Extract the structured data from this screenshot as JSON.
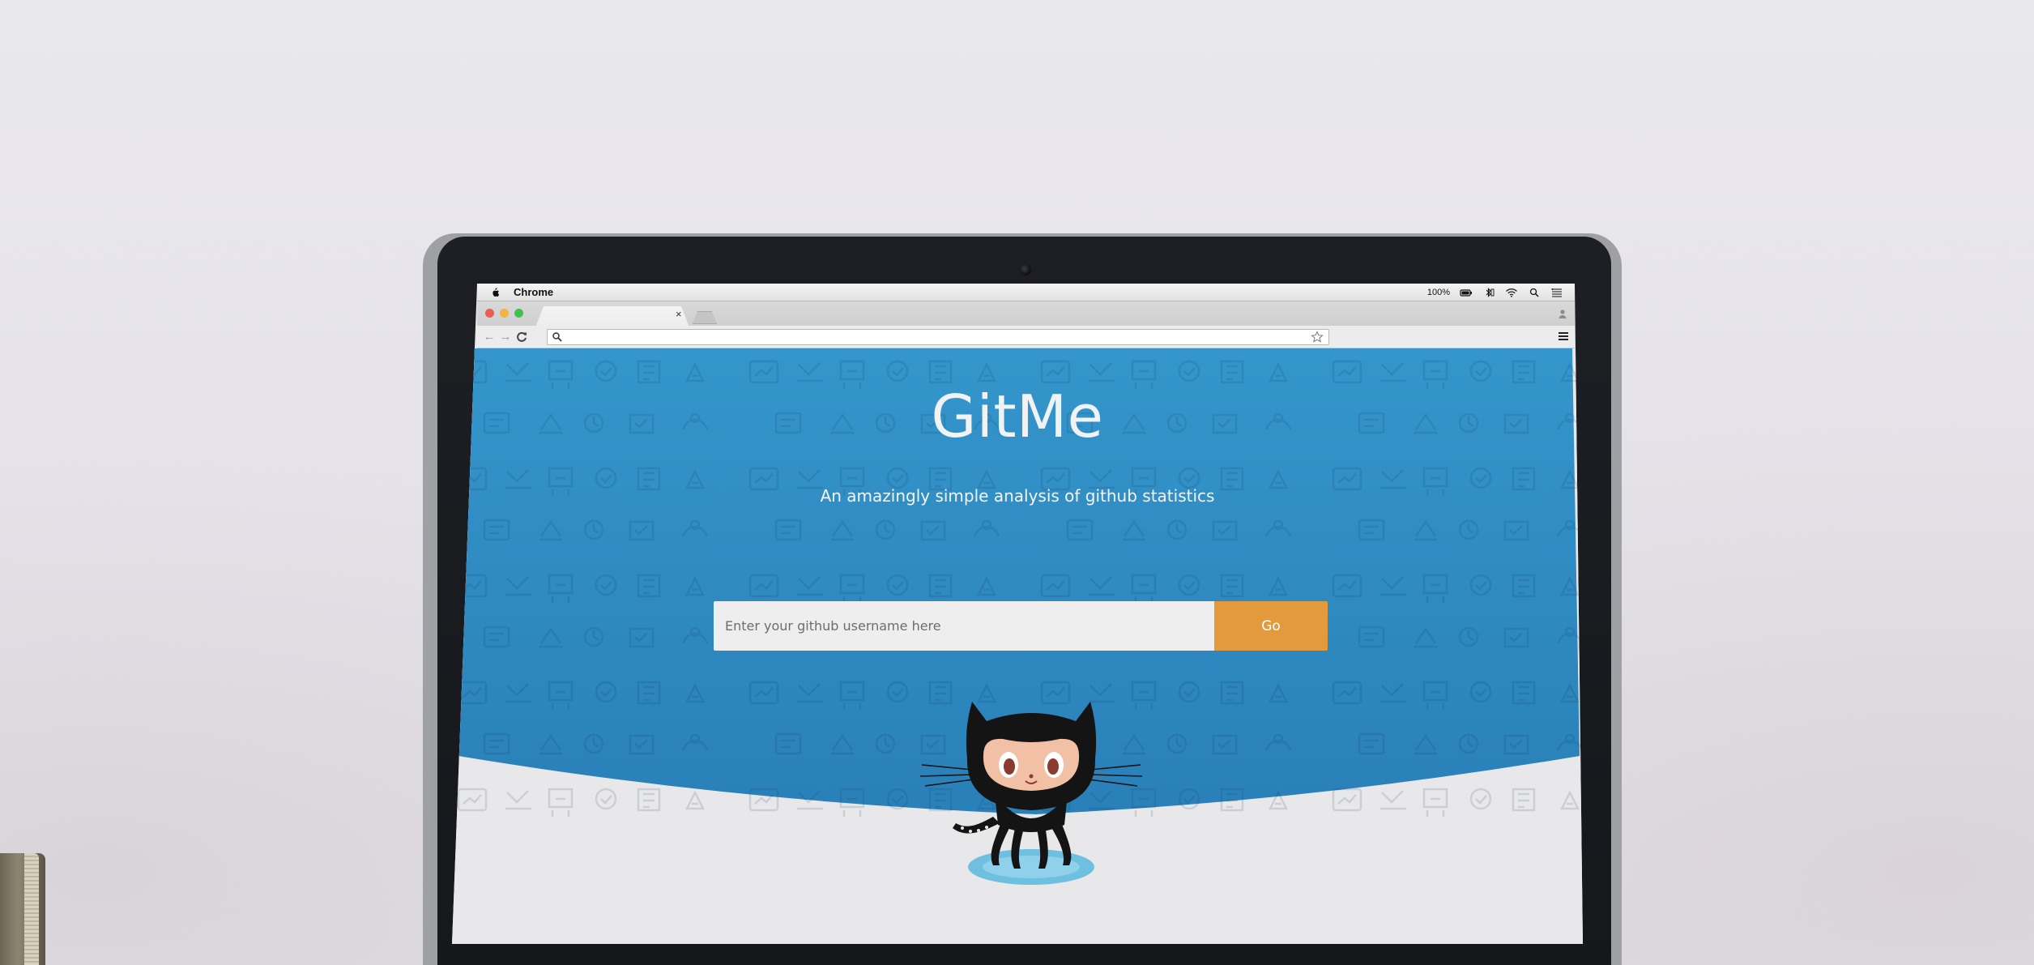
{
  "menubar": {
    "app_name": "Chrome",
    "battery_percent": "100%"
  },
  "browser": {
    "tab_close": "×",
    "address_value": "",
    "nav": {
      "back": "←",
      "forward": "→",
      "reload": "C"
    }
  },
  "page": {
    "brand": "GitMe",
    "tagline": "An amazingly simple analysis of github statistics",
    "search": {
      "placeholder": "Enter your github username here",
      "value": "",
      "button_label": "Go"
    }
  },
  "colors": {
    "hero_blue": "#3392c9",
    "hero_blue_dark": "#2a7fb7",
    "go_orange": "#e29a3c",
    "page_bg": "#e8e8ea"
  },
  "icons": [
    "apple-icon",
    "battery-icon",
    "bluetooth-icon",
    "wifi-icon",
    "spotlight-icon",
    "list-icon",
    "profile-icon",
    "search-icon",
    "star-icon",
    "menu-icon",
    "octocat-mascot"
  ]
}
